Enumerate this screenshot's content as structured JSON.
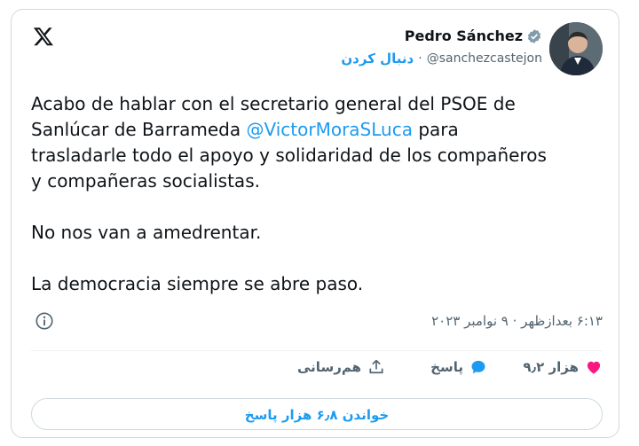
{
  "author": {
    "name": "Pedro Sánchez",
    "handle": "@sanchezcastejon",
    "separator": "·",
    "follow_label": "دنبال کردن"
  },
  "tweet": {
    "line1": "Acabo de hablar con el secretario general del PSOE de",
    "line2_pre": "Sanlúcar de Barrameda ",
    "mention": "@VictorMoraSLuca",
    "line2_post": " para",
    "line3": "trasladarle todo el apoyo y solidaridad de los compañeros",
    "line4": "y compañeras socialistas.",
    "para2": "No nos van a amedrentar.",
    "para3": "La democracia siempre se abre paso."
  },
  "meta": {
    "timestamp": "۶:۱۳ بعدازظهر · ۹ نوامبر ۲۰۲۳"
  },
  "actions": {
    "like_count": "۹٫۲ هزار",
    "reply_label": "پاسخ",
    "share_label": "هم‌رسانی"
  },
  "read_replies_label": "خواندن ۶٫۸ هزار پاسخ",
  "colors": {
    "accent": "#1d9bf0",
    "like": "#f91880",
    "text": "#0f1419",
    "muted": "#536471"
  },
  "icons": {
    "logo": "x-logo-icon",
    "verified": "verified-badge-icon",
    "info": "info-icon",
    "like": "heart-icon",
    "reply": "speech-bubble-icon",
    "share": "share-icon"
  }
}
